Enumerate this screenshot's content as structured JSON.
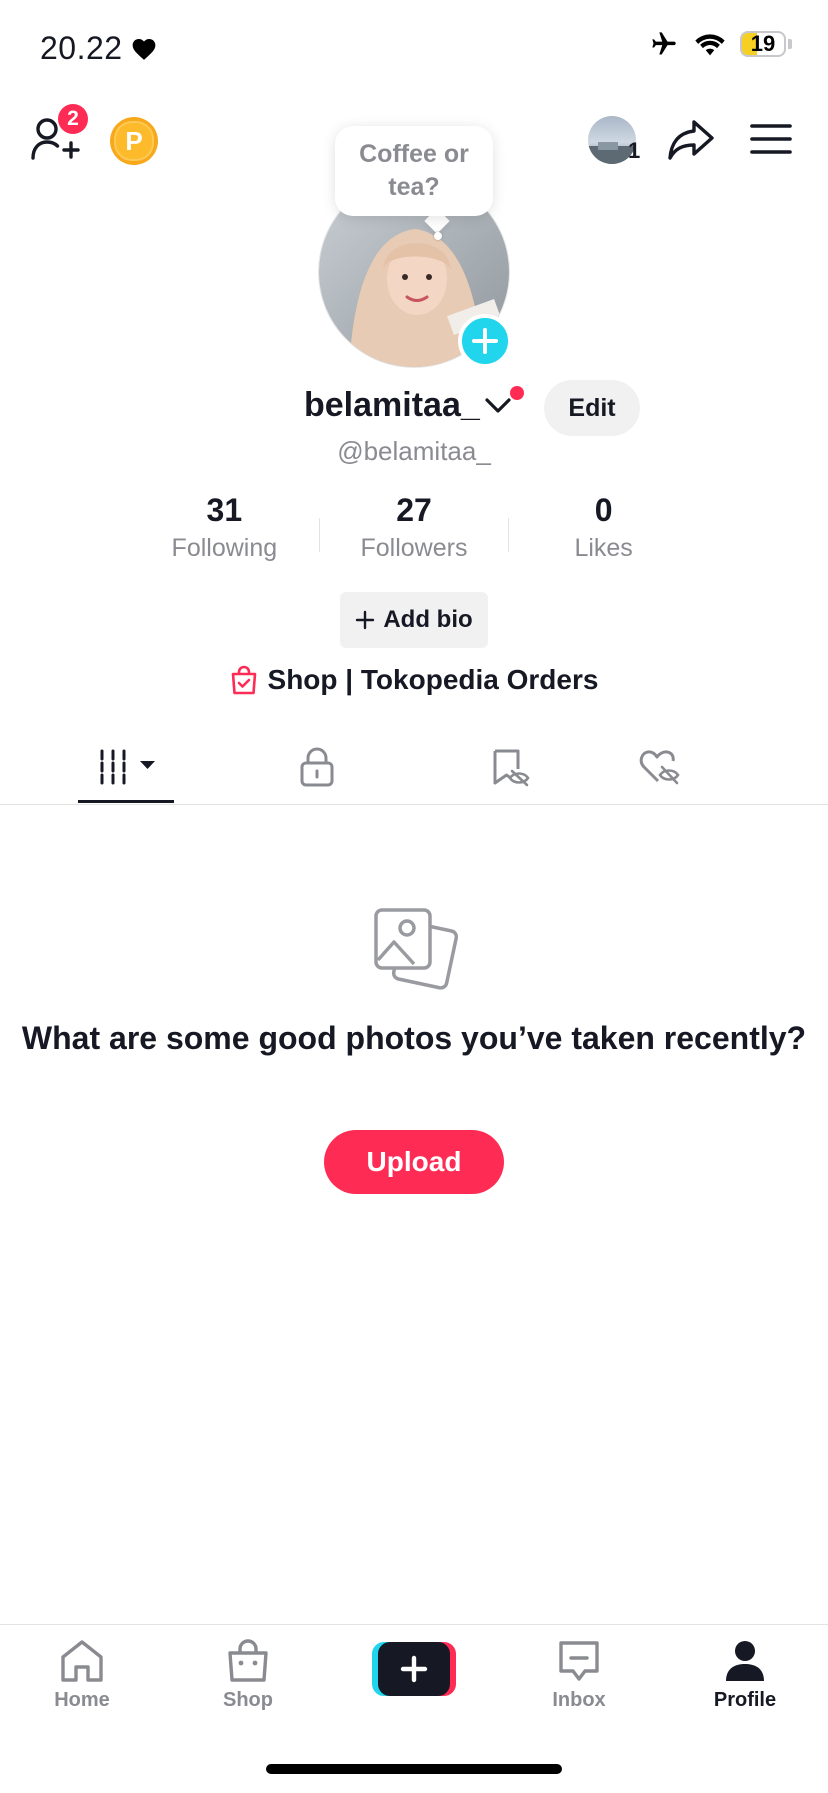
{
  "status_bar": {
    "time": "20.22",
    "battery_level": "19",
    "battery_fraction": 0.19
  },
  "header": {
    "friend_requests_badge": "2",
    "coin_label": "P",
    "story_count": "1"
  },
  "profile": {
    "status_bubble": "Coffee or tea?",
    "display_name": "belamitaa_",
    "handle": "@belamitaa_",
    "edit_label": "Edit",
    "stats": [
      {
        "value": "31",
        "label": "Following"
      },
      {
        "value": "27",
        "label": "Followers"
      },
      {
        "value": "0",
        "label": "Likes"
      }
    ],
    "add_bio_label": "Add bio",
    "shop_link": "Shop | Tokopedia Orders"
  },
  "content_tabs": [
    "videos",
    "private",
    "favorites",
    "liked"
  ],
  "empty_state": {
    "title": "What are some good photos you’ve taken recently?",
    "upload_label": "Upload"
  },
  "bottom_nav": {
    "items": [
      {
        "label": "Home",
        "icon": "home-icon"
      },
      {
        "label": "Shop",
        "icon": "shop-icon"
      },
      {
        "label": "",
        "icon": "create-icon"
      },
      {
        "label": "Inbox",
        "icon": "inbox-icon"
      },
      {
        "label": "Profile",
        "icon": "profile-icon",
        "active": true
      }
    ]
  },
  "colors": {
    "accent": "#fe2c55",
    "cyan": "#20d5ec",
    "text": "#161823",
    "secondary_text": "#8a8b91"
  }
}
